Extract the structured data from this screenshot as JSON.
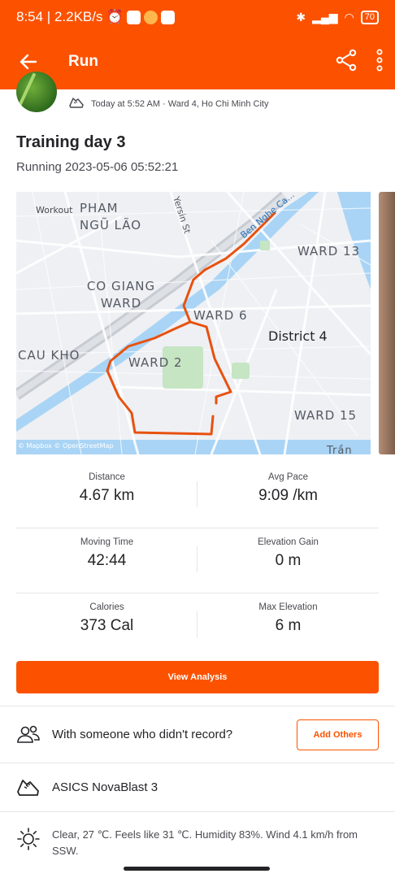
{
  "status_bar": {
    "time_speed": "8:54 | 2.2KB/s",
    "battery": "70"
  },
  "app_bar": {
    "title": "Run",
    "icons": [
      "back-arrow-icon",
      "share-icon",
      "more-vertical-icon"
    ]
  },
  "athlete": {
    "meta": "Today at 5:52 AM · Ward 4, Ho Chi Minh City"
  },
  "activity": {
    "title": "Training day 3",
    "subtitle": "Running 2023-05-06 05:52:21"
  },
  "map": {
    "labels": {
      "workout": "Workout",
      "pham_ngu_lao": "PHAM NGŨ LÃO",
      "yersin": "Yersin St",
      "ben_nghe": "Ben Nghe Ca...",
      "ward13": "WARD 13",
      "co_giang": "CO GIANG WARD",
      "ward6": "WARD 6",
      "district4": "District 4",
      "cau_kho": "CAU KHO",
      "ward2": "WARD 2",
      "ward15": "WARD 15",
      "tran_xu": "Trần Xu",
      "attribution": "© Mapbox © OpenStreetMap"
    },
    "route_color": "#e8510f"
  },
  "stats": [
    {
      "left_label": "Distance",
      "left_value": "4.67 km",
      "right_label": "Avg Pace",
      "right_value": "9:09 /km"
    },
    {
      "left_label": "Moving Time",
      "left_value": "42:44",
      "right_label": "Elevation Gain",
      "right_value": "0 m"
    },
    {
      "left_label": "Calories",
      "left_value": "373 Cal",
      "right_label": "Max Elevation",
      "right_value": "6 m"
    }
  ],
  "actions": {
    "view_analysis": "View Analysis",
    "with_someone": "With someone who didn't record?",
    "add_others": "Add Others"
  },
  "gear": {
    "shoe": "ASICS NovaBlast 3"
  },
  "weather": {
    "text": "Clear, 27 ℃. Feels like 31 ℃. Humidity 83%. Wind 4.1 km/h from SSW."
  },
  "colors": {
    "brand": "#fc5200",
    "text": "#242428"
  }
}
